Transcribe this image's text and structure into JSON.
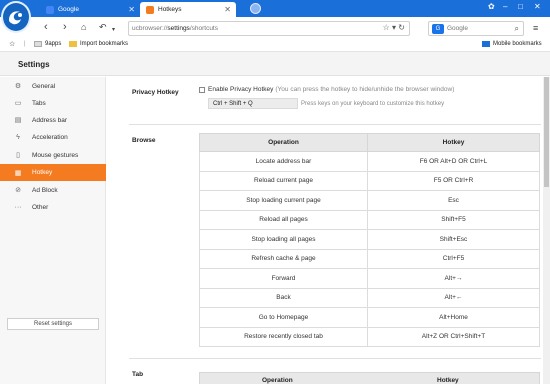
{
  "tabs": [
    {
      "title": "Google",
      "active": false
    },
    {
      "title": "Hotkeys",
      "active": true
    }
  ],
  "address_bar": {
    "url_prefix": "ucbrowser://",
    "url_path": "settings",
    "url_suffix": "/shortcuts"
  },
  "search": {
    "engine": "Google"
  },
  "bookmarks": {
    "items": [
      "9apps",
      "Import bookmarks"
    ],
    "mobile": "Mobile bookmarks"
  },
  "settings": {
    "title": "Settings"
  },
  "sidebar": {
    "items": [
      {
        "label": "General",
        "icon": "gear-icon"
      },
      {
        "label": "Tabs",
        "icon": "tabs-icon"
      },
      {
        "label": "Address bar",
        "icon": "address-bar-icon"
      },
      {
        "label": "Acceleration",
        "icon": "lightning-icon"
      },
      {
        "label": "Mouse gestures",
        "icon": "mouse-icon"
      },
      {
        "label": "Hotkey",
        "icon": "keyboard-icon",
        "active": true
      },
      {
        "label": "Ad Block",
        "icon": "block-icon"
      },
      {
        "label": "Other",
        "icon": "dots-icon"
      }
    ],
    "reset_label": "Reset settings"
  },
  "privacy": {
    "section_title": "Privacy Hotkey",
    "checkbox_label": "Enable Privacy Hotkey",
    "checkbox_note": "(You can press the hotkey to hide/unhide the browser window)",
    "hotkey_value": "Ctrl + Shift + Q",
    "hint": "Press keys on your keyboard to customize this hotkey"
  },
  "browse": {
    "section_title": "Browse",
    "columns": [
      "Operation",
      "Hotkey"
    ],
    "rows": [
      [
        "Locate address bar",
        "F6 OR Alt+D OR Ctrl+L"
      ],
      [
        "Reload current page",
        "F5 OR Ctrl+R"
      ],
      [
        "Stop loading current page",
        "Esc"
      ],
      [
        "Reload all pages",
        "Shift+F5"
      ],
      [
        "Stop loading all pages",
        "Shift+Esc"
      ],
      [
        "Refresh cache & page",
        "Ctrl+F5"
      ],
      [
        "Forward",
        "Alt+→"
      ],
      [
        "Back",
        "Alt+←"
      ],
      [
        "Go to Homepage",
        "Alt+Home"
      ],
      [
        "Restore recently closed tab",
        "Alt+Z OR Ctrl+Shift+T"
      ]
    ]
  },
  "tab_section": {
    "section_title": "Tab",
    "columns": [
      "Operation",
      "Hotkey"
    ]
  },
  "colors": {
    "brand_blue": "#1b6fd8",
    "accent_orange": "#f47b20"
  }
}
